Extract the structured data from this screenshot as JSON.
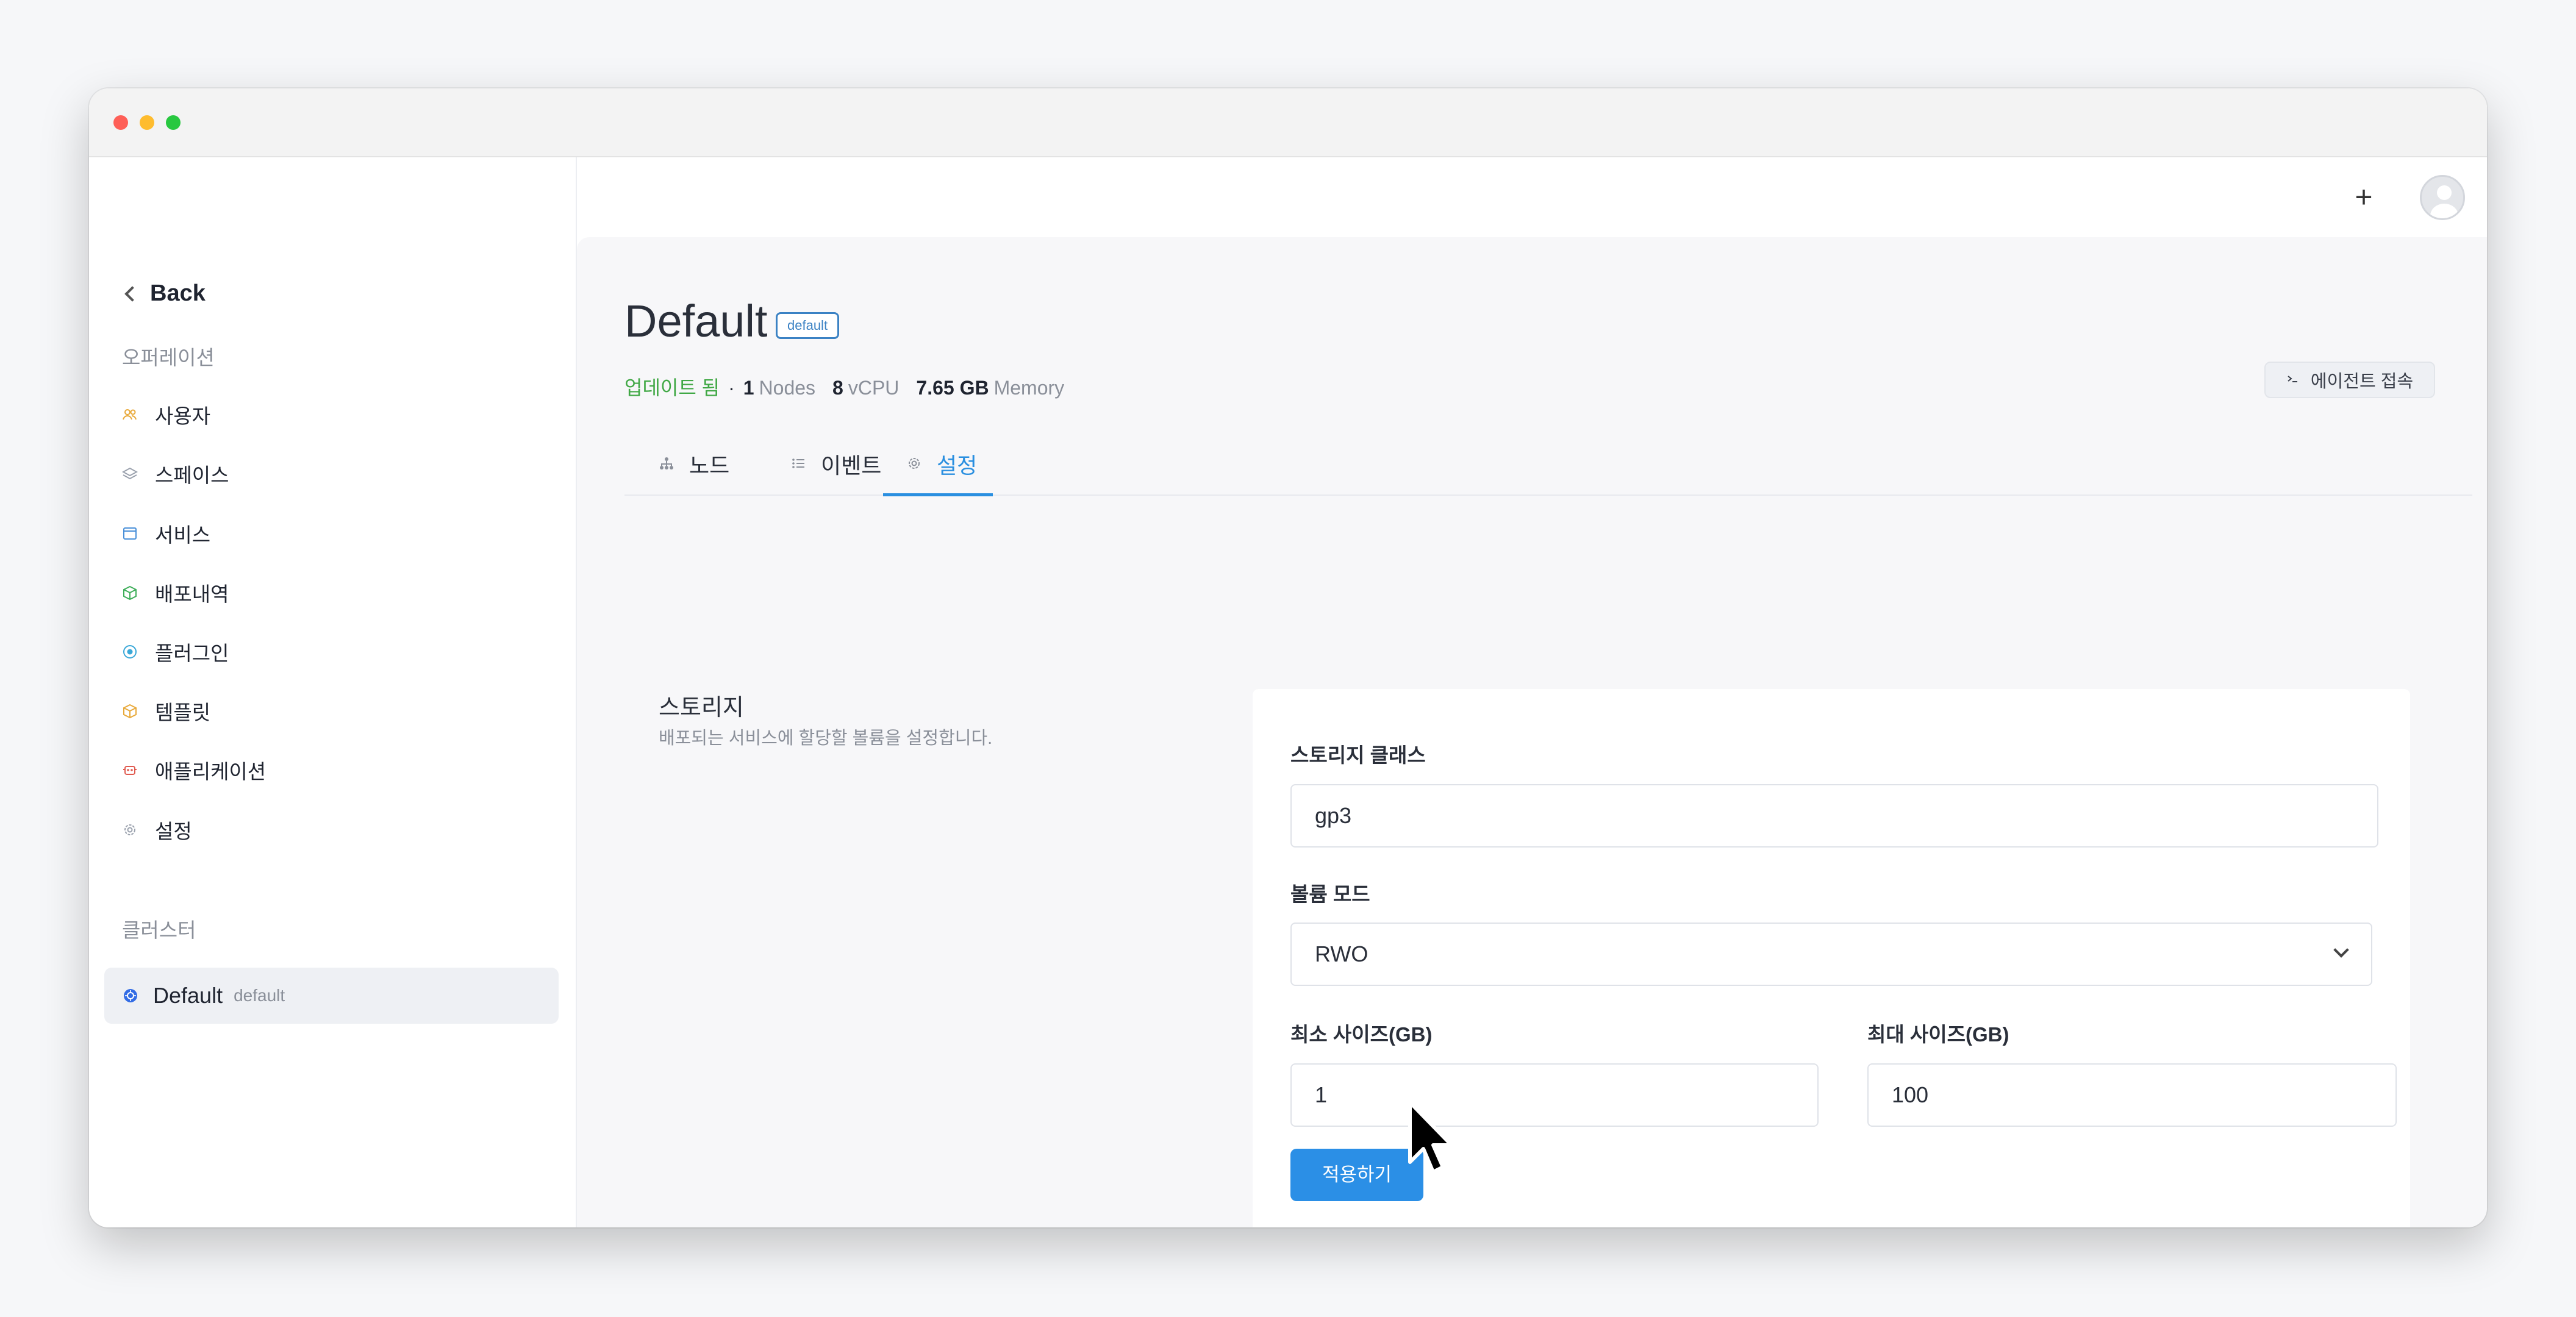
{
  "sidebar": {
    "back_label": "Back",
    "operations_title": "오퍼레이션",
    "items": [
      {
        "label": "사용자",
        "icon": "users-icon"
      },
      {
        "label": "스페이스",
        "icon": "layers-icon"
      },
      {
        "label": "서비스",
        "icon": "window-icon"
      },
      {
        "label": "배포내역",
        "icon": "box-icon"
      },
      {
        "label": "플러그인",
        "icon": "plugin-icon"
      },
      {
        "label": "템플릿",
        "icon": "package-icon"
      },
      {
        "label": "애플리케이션",
        "icon": "robot-icon"
      },
      {
        "label": "설정",
        "icon": "gear-icon"
      }
    ],
    "clusters_title": "클러스터",
    "cluster": {
      "name": "Default",
      "tag": "default"
    }
  },
  "header": {
    "add_label": "+"
  },
  "page": {
    "title": "Default",
    "badge": "default",
    "status": "업데이트 됨",
    "separator": "·",
    "nodes_count": "1",
    "nodes_label": "Nodes",
    "vcpu_count": "8",
    "vcpu_label": "vCPU",
    "memory_value": "7.65 GB",
    "memory_label": "Memory",
    "agent_button": "에이전트 접속"
  },
  "tabs": [
    {
      "label": "노드",
      "icon": "hierarchy-icon"
    },
    {
      "label": "이벤트",
      "icon": "list-icon"
    },
    {
      "label": "설정",
      "icon": "gear-icon",
      "active": true
    }
  ],
  "storage": {
    "title": "스토리지",
    "description": "배포되는 서비스에 할당할 볼륨을 설정합니다.",
    "class_label": "스토리지 클래스",
    "class_value": "gp3",
    "mode_label": "볼륨 모드",
    "mode_value": "RWO",
    "min_label": "최소 사이즈(GB)",
    "min_value": "1",
    "max_label": "최대 사이즈(GB)",
    "max_value": "100",
    "apply_label": "적용하기"
  },
  "colors": {
    "accent": "#2b8fe6",
    "status_green": "#40a845",
    "muted": "#8a8f99"
  }
}
